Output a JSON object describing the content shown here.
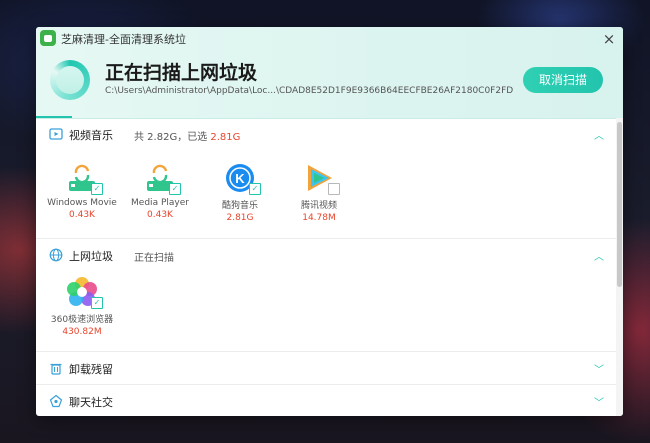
{
  "window": {
    "title": "芝麻清理-全面清理系统垃",
    "close_label": "×"
  },
  "header": {
    "main_title": "正在扫描上网垃圾",
    "scan_path": "C:\\Users\\Administrator\\AppData\\Loc...\\CDAD8E52D1F9E9366B64EECFBE26AF2180C0F2FD",
    "cancel_label": "取消扫描"
  },
  "sections": {
    "video_music": {
      "title": "视频音乐",
      "summary_prefix": "共 2.82G，已选 ",
      "summary_selected": "2.81G",
      "items": [
        {
          "name": "Windows Movie",
          "size": "0.43K",
          "checked": true
        },
        {
          "name": "Media Player",
          "size": "0.43K",
          "checked": true
        },
        {
          "name": "酷狗音乐",
          "size": "2.81G",
          "checked": true
        },
        {
          "name": "腾讯视频",
          "size": "14.78M",
          "checked": false
        }
      ]
    },
    "web_junk": {
      "title": "上网垃圾",
      "status": "正在扫描",
      "items": [
        {
          "name": "360极速浏览器",
          "size": "430.82M",
          "checked": true
        }
      ]
    },
    "uninstall": {
      "title": "卸载残留"
    },
    "chat": {
      "title": "聊天社交"
    }
  },
  "colors": {
    "accent": "#22c4ad",
    "highlight": "#e8452c"
  }
}
